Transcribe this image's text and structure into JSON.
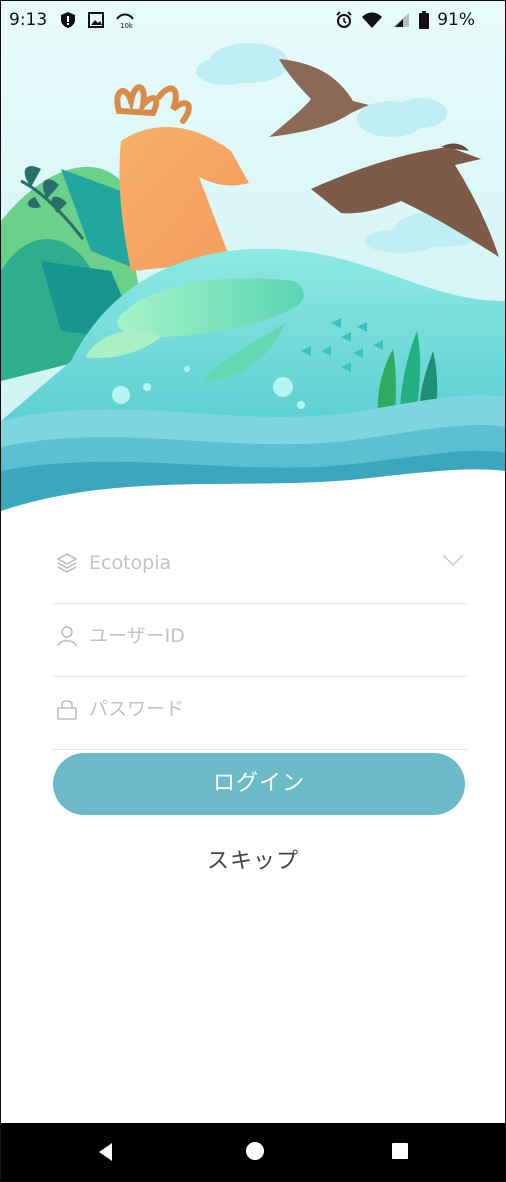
{
  "status_bar": {
    "time": "9:13",
    "battery": "91%",
    "left_icons": [
      "shield-icon",
      "image-icon",
      "data-speed-icon"
    ],
    "right_icons": [
      "alarm-icon",
      "wifi-icon",
      "signal-icon",
      "battery-icon"
    ]
  },
  "hero": {
    "description_icons": [
      "deer-icon",
      "eagle-icon",
      "sea-turtle-icon",
      "fish-icon",
      "seaweed-icon"
    ]
  },
  "form": {
    "server": {
      "value": "Ecotopia",
      "icon": "layers-icon",
      "dropdown_icon": "chevron-down-icon"
    },
    "user_id": {
      "placeholder": "ユーザーID",
      "icon": "user-icon"
    },
    "password": {
      "placeholder": "パスワード",
      "icon": "lock-icon"
    },
    "login_label": "ログイン",
    "skip_label": "スキップ"
  },
  "colors": {
    "accent": "#6cbac8",
    "placeholder": "#c2c2c2",
    "water": "#5fd0d6"
  },
  "nav": {
    "icons": [
      "back-icon",
      "home-icon",
      "recents-icon"
    ]
  }
}
